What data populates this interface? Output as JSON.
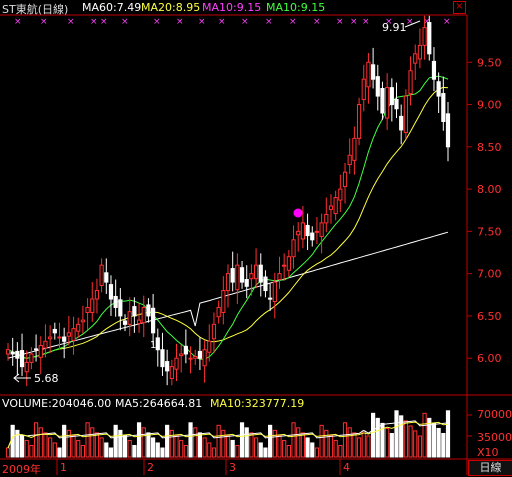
{
  "header": {
    "title": "ST東航(日線)",
    "ma60": "MA60:7.49",
    "ma20": "MA20:8.95",
    "ma10a": "MA10:9.15",
    "ma10b": "MA10:9.15"
  },
  "annotations": {
    "high_label": "9.91",
    "low_label": "5.68",
    "marker_label": "1"
  },
  "price_axis": {
    "ticks": [
      "9.50",
      "9.00",
      "8.50",
      "8.00",
      "7.50",
      "7.00",
      "6.50",
      "6.00"
    ]
  },
  "volume": {
    "label": "VOLUME:204046.00",
    "ma5": "MA5:264664.81",
    "ma10": "MA10:323777.19",
    "ticks": [
      "70000",
      "35000"
    ],
    "unit": "X10"
  },
  "time_axis": {
    "labels": [
      "2009年",
      "1",
      "2",
      "3",
      "4"
    ],
    "period_button": "日線"
  },
  "colors": {
    "up": "#ff3030",
    "down": "#ffffff",
    "ma_white": "#ffffff",
    "ma_yellow": "#ffff40",
    "ma_magenta": "#ff40ff",
    "ma_green": "#40ff40",
    "axis": "#c00000"
  },
  "chart_data": {
    "type": "candlestick",
    "ylim": [
      5.6,
      10.0
    ],
    "series_closes": [
      6.1,
      6.05,
      6.0,
      5.9,
      5.95,
      6.05,
      6.1,
      6.15,
      6.2,
      6.25,
      6.3,
      6.25,
      6.2,
      6.3,
      6.35,
      6.4,
      6.45,
      6.6,
      6.7,
      6.8,
      7.1,
      6.9,
      6.7,
      6.6,
      6.5,
      6.4,
      6.55,
      6.5,
      6.45,
      6.6,
      6.5,
      6.3,
      6.1,
      5.9,
      5.85,
      5.9,
      6.0,
      6.05,
      6.05,
      6.0,
      6.02,
      6.0,
      6.1,
      6.2,
      6.4,
      6.6,
      6.8,
      7.0,
      6.9,
      7.1,
      6.9,
      6.85,
      7.0,
      7.1,
      6.9,
      6.8,
      6.7,
      6.9,
      7.0,
      7.1,
      7.2,
      7.4,
      7.5,
      7.6,
      7.45,
      7.4,
      7.5,
      7.6,
      7.7,
      7.8,
      7.9,
      8.0,
      8.2,
      8.4,
      8.6,
      9.0,
      9.3,
      9.5,
      9.3,
      9.1,
      8.9,
      9.2,
      9.0,
      8.95,
      8.7,
      9.1,
      9.4,
      9.6,
      9.7,
      9.91,
      9.6,
      9.3,
      9.1,
      8.8,
      8.5
    ],
    "ma_white": "60-day",
    "ma_yellow": "20-day",
    "ma_green": "10-day"
  }
}
